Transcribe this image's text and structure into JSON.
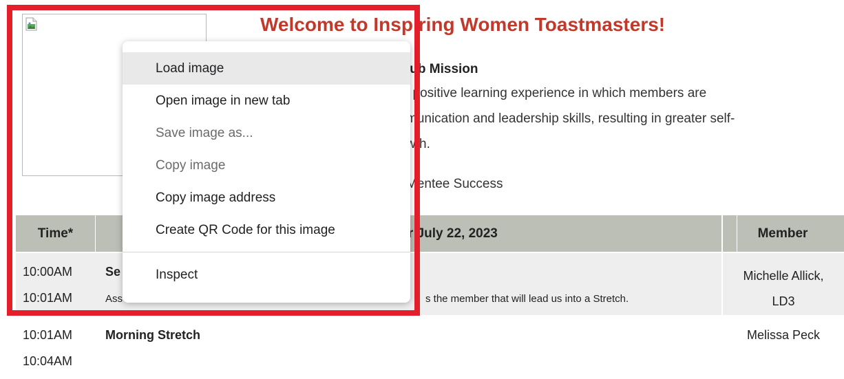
{
  "page": {
    "welcome": "Welcome to Inspiring Women Toastmasters!",
    "mission_title": "lub Mission",
    "mission_lines": [
      "l positive learning experience in which members are",
      "munication and leadership skills, resulting in greater self-",
      "wth."
    ],
    "mentee_text": "Mentee Success"
  },
  "agenda": {
    "headers": {
      "time": "Time*",
      "title": "for July 22, 2023",
      "member": "Member"
    },
    "rows": [
      {
        "time_start": "10:00AM",
        "time_end": "10:01AM",
        "title": "Se",
        "desc_left": "Ass",
        "desc_right": "s the member that will lead us into a Stretch.",
        "member": "Michelle Allick,\nLD3"
      },
      {
        "time_start": "10:01AM",
        "time_end": "10:04AM",
        "title": "Morning Stretch",
        "member": "Melissa Peck"
      }
    ]
  },
  "context_menu": {
    "items": [
      {
        "label": "Load image",
        "state": "hovered"
      },
      {
        "label": "Open image in new tab",
        "state": "enabled"
      },
      {
        "label": "Save image as...",
        "state": "disabled"
      },
      {
        "label": "Copy image",
        "state": "disabled"
      },
      {
        "label": "Copy image address",
        "state": "enabled"
      },
      {
        "label": "Create QR Code for this image",
        "state": "enabled"
      },
      {
        "label": "Inspect",
        "state": "enabled"
      }
    ]
  },
  "colors": {
    "welcome_title": "#c0392b",
    "highlight_border": "#e41e2b",
    "table_header_bg": "#bcbfb6",
    "row_alt_bg": "#eeeeee"
  },
  "icons": {
    "placeholder": "broken-image-icon"
  }
}
